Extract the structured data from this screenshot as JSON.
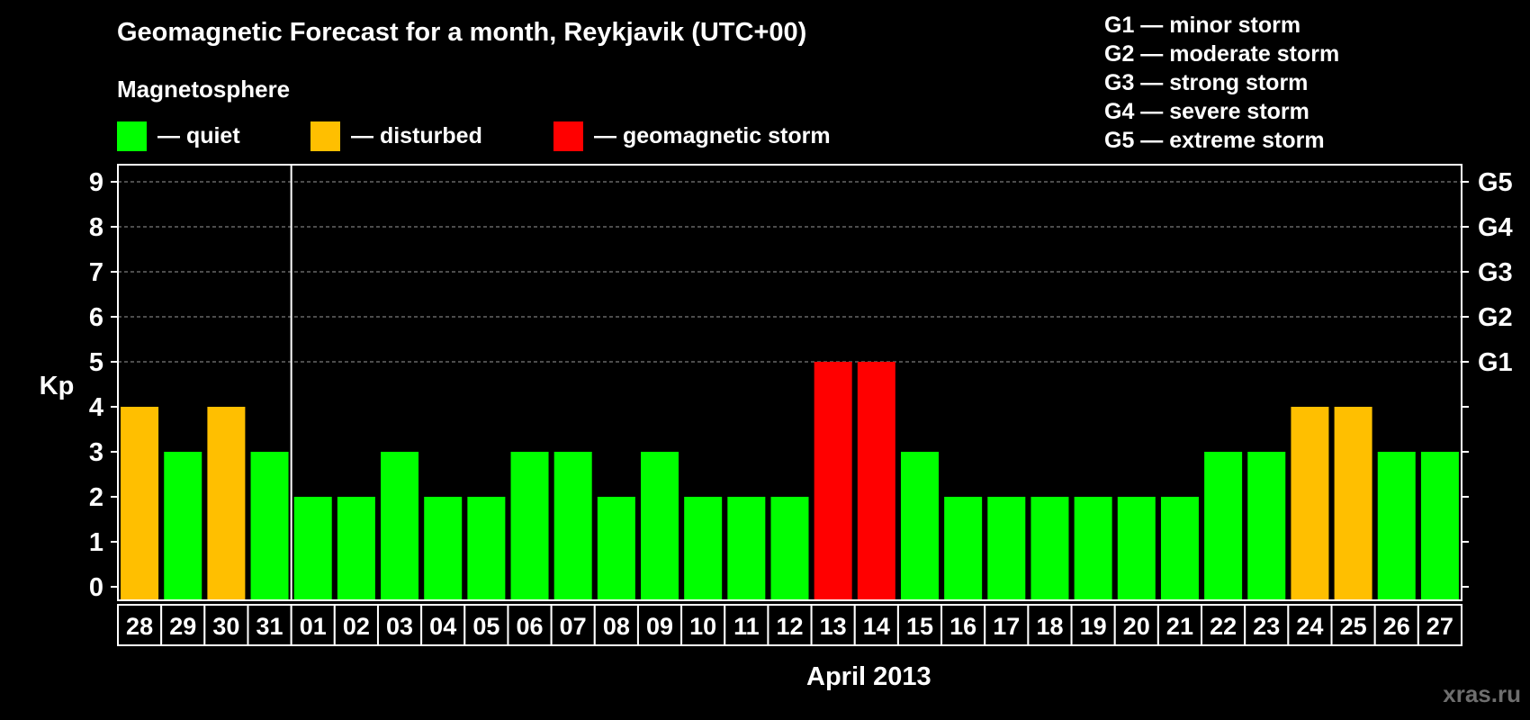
{
  "header": {
    "title": "Geomagnetic Forecast for a month, Reykjavik (UTC+00)",
    "legend_heading": "Magnetosphere",
    "legend": [
      {
        "label": "— quiet",
        "color": "#00ff00"
      },
      {
        "label": "— disturbed",
        "color": "#ffbf00"
      },
      {
        "label": "— geomagnetic storm",
        "color": "#ff0000"
      }
    ],
    "storm_levels": [
      "G1 — minor storm",
      "G2 — moderate storm",
      "G3 — strong storm",
      "G4 — severe storm",
      "G5 — extreme storm"
    ]
  },
  "chart_data": {
    "type": "bar",
    "ylabel": "Kp",
    "xlabel": "April 2013",
    "ylim": [
      0,
      9
    ],
    "yticks": [
      "0",
      "1",
      "2",
      "3",
      "4",
      "5",
      "6",
      "7",
      "8",
      "9"
    ],
    "right_ticks": [
      {
        "value": 5,
        "label": "G1"
      },
      {
        "value": 6,
        "label": "G2"
      },
      {
        "value": 7,
        "label": "G3"
      },
      {
        "value": 8,
        "label": "G4"
      },
      {
        "value": 9,
        "label": "G5"
      }
    ],
    "categories": [
      "28",
      "29",
      "30",
      "31",
      "01",
      "02",
      "03",
      "04",
      "05",
      "06",
      "07",
      "08",
      "09",
      "10",
      "11",
      "12",
      "13",
      "14",
      "15",
      "16",
      "17",
      "18",
      "19",
      "20",
      "21",
      "22",
      "23",
      "24",
      "25",
      "26",
      "27"
    ],
    "values": [
      4,
      3,
      4,
      3,
      2,
      2,
      3,
      2,
      2,
      3,
      3,
      2,
      3,
      2,
      2,
      2,
      5,
      5,
      3,
      2,
      2,
      2,
      2,
      2,
      2,
      3,
      3,
      4,
      4,
      3,
      3
    ],
    "status": [
      "disturbed",
      "quiet",
      "disturbed",
      "quiet",
      "quiet",
      "quiet",
      "quiet",
      "quiet",
      "quiet",
      "quiet",
      "quiet",
      "quiet",
      "quiet",
      "quiet",
      "quiet",
      "quiet",
      "storm",
      "storm",
      "quiet",
      "quiet",
      "quiet",
      "quiet",
      "quiet",
      "quiet",
      "quiet",
      "quiet",
      "quiet",
      "disturbed",
      "disturbed",
      "quiet",
      "quiet"
    ],
    "colors": {
      "quiet": "#00ff00",
      "disturbed": "#ffbf00",
      "storm": "#ff0000"
    },
    "grid": true,
    "month_divider_after": "31"
  },
  "watermark": "xras.ru"
}
